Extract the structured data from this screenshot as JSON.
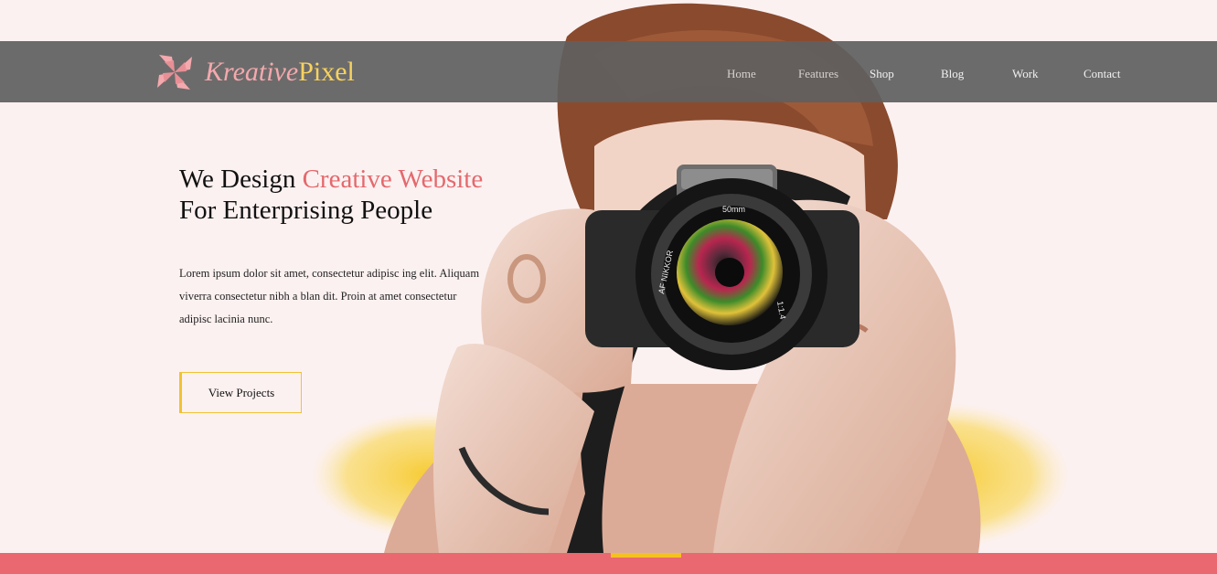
{
  "brand": {
    "name_part1": "Kreative",
    "name_part2": "Pixel",
    "logo_icon": "pinwheel-logo-icon"
  },
  "nav": {
    "items": [
      {
        "label": "Home"
      },
      {
        "label": "Features"
      },
      {
        "label": "Shop"
      },
      {
        "label": "Blog"
      },
      {
        "label": "Work"
      },
      {
        "label": "Contact"
      }
    ]
  },
  "hero": {
    "headline_line1_start": "We Design ",
    "headline_line1_accent": "Creative Website",
    "headline_line2": "For Enterprising People",
    "description": "Lorem ipsum dolor sit amet, consectetur adipisc ing elit. Aliquam viverra consectetur nibh a blan dit. Proin at amet consectetur adipisc lacinia nunc.",
    "cta_label": "View Projects",
    "image_text": {
      "lens_focal": "50mm",
      "lens_brand": "AF NIKKOR",
      "aperture": "1:1.4"
    }
  },
  "colors": {
    "background": "#fcf1f1",
    "accent": "#e4696d",
    "brand_pink": "#f4a9ae",
    "brand_yellow": "#f7d25f",
    "cta_border": "#f1c232",
    "footer": "#ea6870",
    "footer_indicator": "#f5c11f",
    "navbar": "#5f5f5f"
  }
}
